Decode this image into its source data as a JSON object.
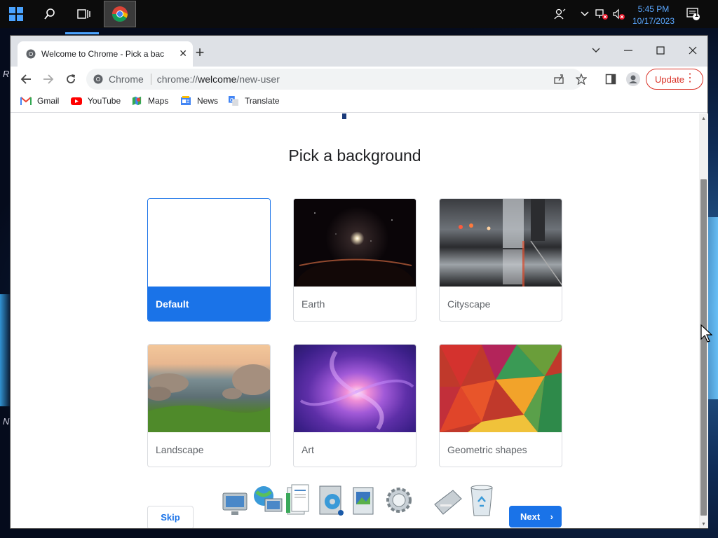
{
  "taskbar": {
    "time": "5:45 PM",
    "date": "10/17/2023",
    "notification_count": "1"
  },
  "desktop": {
    "edge_letters": [
      "R",
      "N"
    ]
  },
  "browser": {
    "tab_title": "Welcome to Chrome - Pick a bac",
    "omnibox_chip": "Chrome",
    "url_prefix": "chrome://",
    "url_host": "welcome",
    "url_path": "/new-user",
    "update_label": "Update",
    "bookmarks": [
      "Gmail",
      "YouTube",
      "Maps",
      "News",
      "Translate"
    ]
  },
  "page": {
    "heading": "Pick a background",
    "cards": [
      {
        "label": "Default",
        "selected": true
      },
      {
        "label": "Earth",
        "selected": false
      },
      {
        "label": "Cityscape",
        "selected": false
      },
      {
        "label": "Landscape",
        "selected": false
      },
      {
        "label": "Art",
        "selected": false
      },
      {
        "label": "Geometric shapes",
        "selected": false
      }
    ],
    "skip_label": "Skip",
    "next_label": "Next"
  },
  "colors": {
    "accent": "#1a73e8",
    "update": "#d93025",
    "taskbar": "#0c0c0c"
  }
}
